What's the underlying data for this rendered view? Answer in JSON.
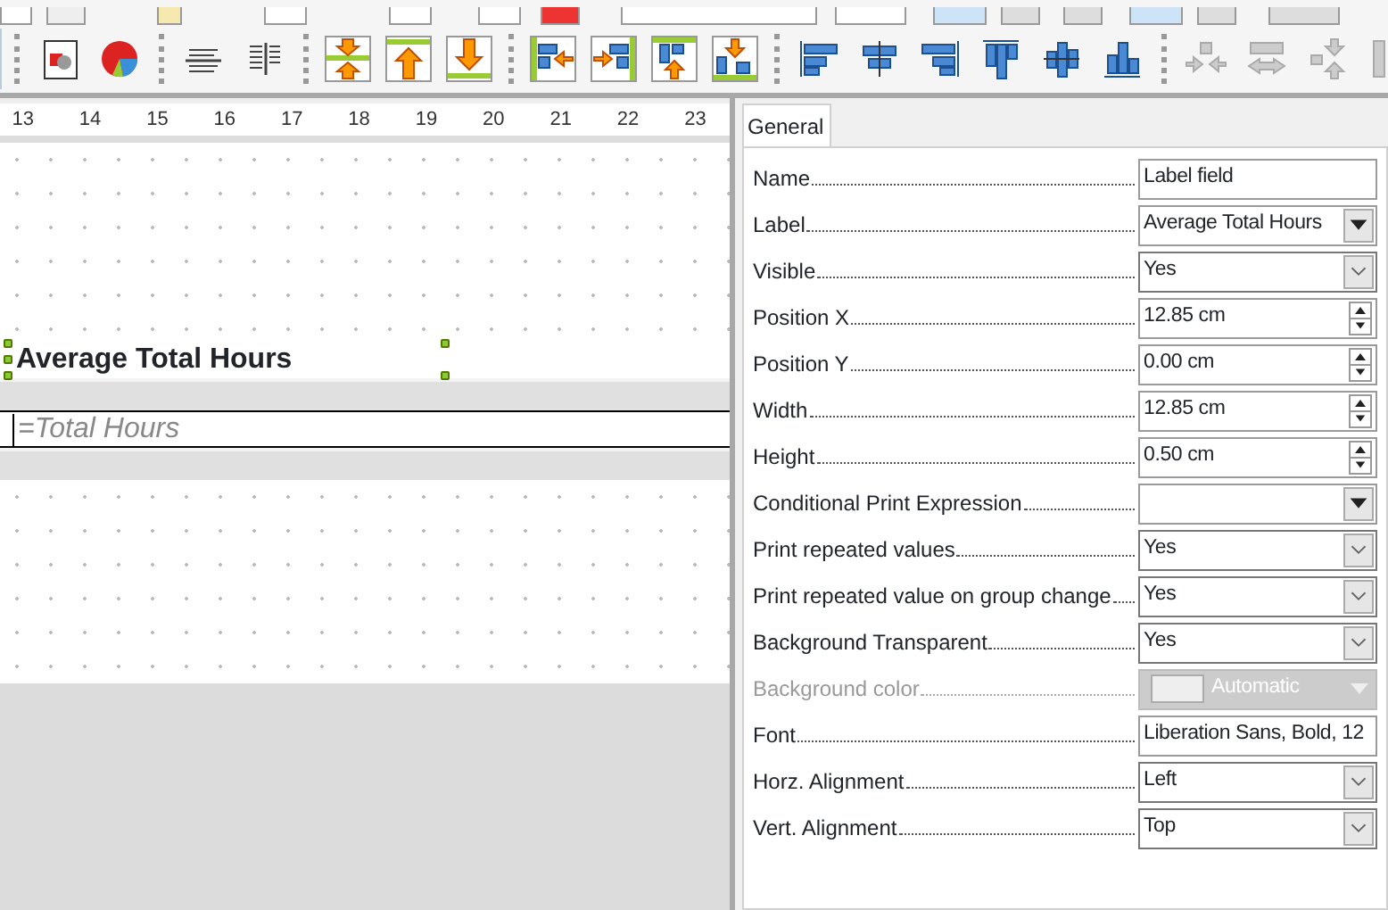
{
  "ruler": {
    "marks": [
      "13",
      "14",
      "15",
      "16",
      "17",
      "18",
      "19",
      "20",
      "21",
      "22",
      "23"
    ]
  },
  "report": {
    "label_text": "Average Total Hours",
    "field_text": "=Total Hours"
  },
  "panel": {
    "tabs": [
      {
        "label": "General",
        "selected": true
      }
    ],
    "properties": [
      {
        "label": "Name",
        "kind": "text",
        "value": "Label field",
        "disabled": false
      },
      {
        "label": "Label",
        "kind": "combo",
        "value": "Average Total Hours",
        "disabled": false
      },
      {
        "label": "Visible",
        "kind": "select",
        "value": "Yes",
        "disabled": false
      },
      {
        "label": "Position X",
        "kind": "spin",
        "value": "12.85 cm",
        "disabled": false
      },
      {
        "label": "Position Y",
        "kind": "spin",
        "value": "0.00 cm",
        "disabled": false
      },
      {
        "label": "Width",
        "kind": "spin",
        "value": "12.85 cm",
        "disabled": false
      },
      {
        "label": "Height",
        "kind": "spin",
        "value": "0.50 cm",
        "disabled": false
      },
      {
        "label": "Conditional Print Expression",
        "kind": "combo",
        "disabled": false
      },
      {
        "label": "Print repeated values",
        "kind": "select",
        "value": "Yes",
        "disabled": false
      },
      {
        "label": "Print repeated value on group change",
        "kind": "select",
        "value": "Yes",
        "disabled": false
      },
      {
        "label": "Background Transparent",
        "kind": "select",
        "value": "Yes",
        "disabled": false
      },
      {
        "label": "Background color",
        "kind": "color",
        "value": "Automatic",
        "disabled": true
      },
      {
        "label": "Font",
        "kind": "text",
        "value": "Liberation Sans, Bold, 12",
        "disabled": false
      },
      {
        "label": "Horz. Alignment",
        "kind": "select",
        "value": "Left",
        "disabled": false
      },
      {
        "label": "Vert. Alignment",
        "kind": "select",
        "value": "Top",
        "disabled": false
      }
    ]
  }
}
